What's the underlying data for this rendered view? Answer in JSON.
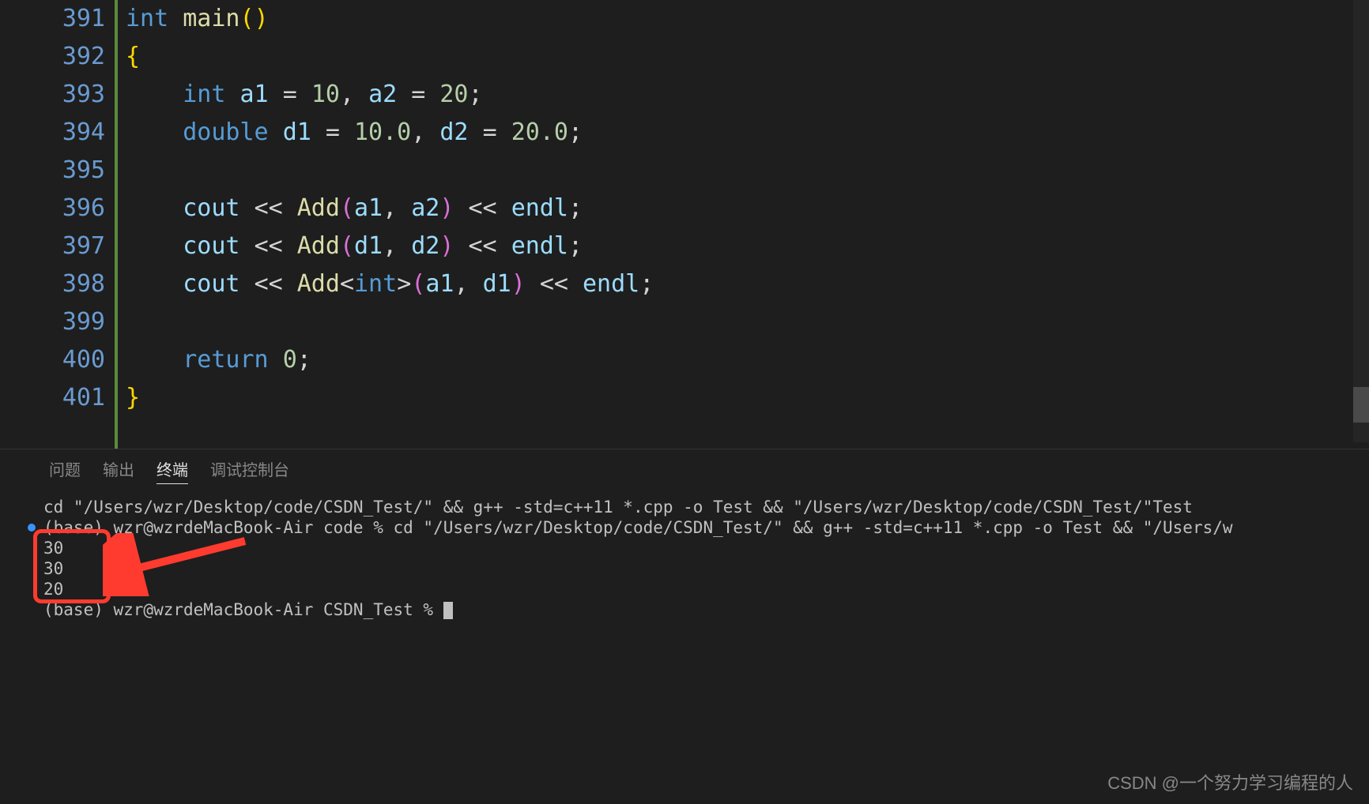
{
  "lines": [
    {
      "num": "391",
      "tokens": [
        [
          "kw",
          "int"
        ],
        [
          "op",
          " "
        ],
        [
          "func",
          "main"
        ],
        [
          "paren-y",
          "("
        ],
        [
          "paren-y",
          ")"
        ]
      ]
    },
    {
      "num": "392",
      "tokens": [
        [
          "brace-y",
          "{"
        ]
      ]
    },
    {
      "num": "393",
      "indent": 1,
      "tokens": [
        [
          "type",
          "int"
        ],
        [
          "op",
          " "
        ],
        [
          "ident",
          "a1"
        ],
        [
          "op",
          " "
        ],
        [
          "op",
          "="
        ],
        [
          "op",
          " "
        ],
        [
          "num",
          "10"
        ],
        [
          "punct",
          ","
        ],
        [
          "op",
          " "
        ],
        [
          "ident",
          "a2"
        ],
        [
          "op",
          " "
        ],
        [
          "op",
          "="
        ],
        [
          "op",
          " "
        ],
        [
          "num",
          "20"
        ],
        [
          "punct",
          ";"
        ]
      ]
    },
    {
      "num": "394",
      "indent": 1,
      "tokens": [
        [
          "type",
          "double"
        ],
        [
          "op",
          " "
        ],
        [
          "ident",
          "d1"
        ],
        [
          "op",
          " "
        ],
        [
          "op",
          "="
        ],
        [
          "op",
          " "
        ],
        [
          "num",
          "10.0"
        ],
        [
          "punct",
          ","
        ],
        [
          "op",
          " "
        ],
        [
          "ident",
          "d2"
        ],
        [
          "op",
          " "
        ],
        [
          "op",
          "="
        ],
        [
          "op",
          " "
        ],
        [
          "num",
          "20.0"
        ],
        [
          "punct",
          ";"
        ]
      ]
    },
    {
      "num": "395",
      "indent": 1,
      "tokens": []
    },
    {
      "num": "396",
      "indent": 1,
      "tokens": [
        [
          "ident",
          "cout"
        ],
        [
          "op",
          " "
        ],
        [
          "op",
          "<<"
        ],
        [
          "op",
          " "
        ],
        [
          "func",
          "Add"
        ],
        [
          "paren-p",
          "("
        ],
        [
          "ident",
          "a1"
        ],
        [
          "punct",
          ","
        ],
        [
          "op",
          " "
        ],
        [
          "ident",
          "a2"
        ],
        [
          "paren-p",
          ")"
        ],
        [
          "op",
          " "
        ],
        [
          "op",
          "<<"
        ],
        [
          "op",
          " "
        ],
        [
          "ident",
          "endl"
        ],
        [
          "punct",
          ";"
        ]
      ]
    },
    {
      "num": "397",
      "indent": 1,
      "tokens": [
        [
          "ident",
          "cout"
        ],
        [
          "op",
          " "
        ],
        [
          "op",
          "<<"
        ],
        [
          "op",
          " "
        ],
        [
          "func",
          "Add"
        ],
        [
          "paren-p",
          "("
        ],
        [
          "ident",
          "d1"
        ],
        [
          "punct",
          ","
        ],
        [
          "op",
          " "
        ],
        [
          "ident",
          "d2"
        ],
        [
          "paren-p",
          ")"
        ],
        [
          "op",
          " "
        ],
        [
          "op",
          "<<"
        ],
        [
          "op",
          " "
        ],
        [
          "ident",
          "endl"
        ],
        [
          "punct",
          ";"
        ]
      ]
    },
    {
      "num": "398",
      "indent": 1,
      "tokens": [
        [
          "ident",
          "cout"
        ],
        [
          "op",
          " "
        ],
        [
          "op",
          "<<"
        ],
        [
          "op",
          " "
        ],
        [
          "func",
          "Add"
        ],
        [
          "punct",
          "<"
        ],
        [
          "type",
          "int"
        ],
        [
          "punct",
          ">"
        ],
        [
          "paren-p",
          "("
        ],
        [
          "ident",
          "a1"
        ],
        [
          "punct",
          ","
        ],
        [
          "op",
          " "
        ],
        [
          "ident",
          "d1"
        ],
        [
          "paren-p",
          ")"
        ],
        [
          "op",
          " "
        ],
        [
          "op",
          "<<"
        ],
        [
          "op",
          " "
        ],
        [
          "ident",
          "endl"
        ],
        [
          "punct",
          ";"
        ]
      ]
    },
    {
      "num": "399",
      "indent": 1,
      "tokens": []
    },
    {
      "num": "400",
      "indent": 1,
      "tokens": [
        [
          "kw",
          "return"
        ],
        [
          "op",
          " "
        ],
        [
          "num",
          "0"
        ],
        [
          "punct",
          ";"
        ]
      ]
    },
    {
      "num": "401",
      "tokens": [
        [
          "brace-y",
          "}"
        ]
      ]
    }
  ],
  "panel": {
    "tabs": {
      "problems": "问题",
      "output": "输出",
      "terminal": "终端",
      "debug": "调试控制台"
    }
  },
  "terminal_lines": [
    "cd \"/Users/wzr/Desktop/code/CSDN_Test/\" && g++ -std=c++11 *.cpp -o Test && \"/Users/wzr/Desktop/code/CSDN_Test/\"Test",
    "(base) wzr@wzrdeMacBook-Air code % cd \"/Users/wzr/Desktop/code/CSDN_Test/\" && g++ -std=c++11 *.cpp -o Test && \"/Users/w",
    "30",
    "30",
    "20",
    "(base) wzr@wzrdeMacBook-Air CSDN_Test % "
  ],
  "watermark": "CSDN @一个努力学习编程的人"
}
